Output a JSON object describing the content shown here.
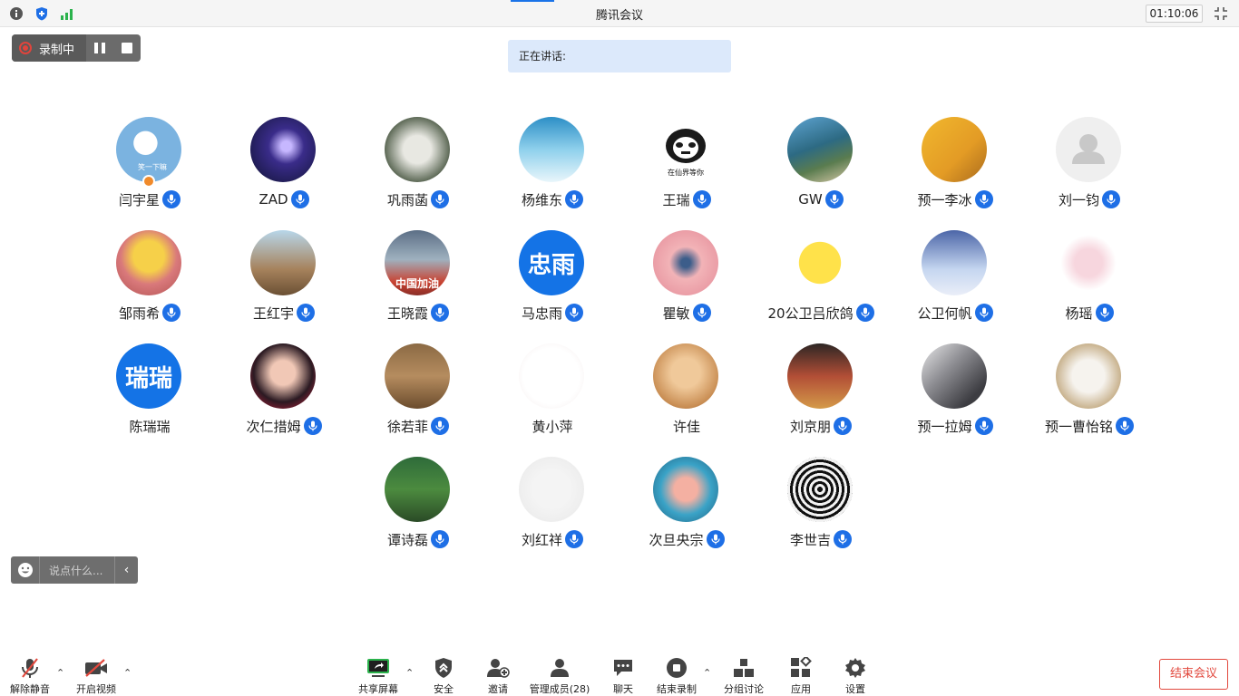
{
  "titlebar": {
    "title": "腾讯会议",
    "timer": "01:10:06"
  },
  "recording": {
    "label": "录制中"
  },
  "speaking": {
    "label": "正在讲话:"
  },
  "participants": [
    {
      "name": "闫宇星",
      "mic": true
    },
    {
      "name": "ZAD",
      "mic": true
    },
    {
      "name": "巩雨菡",
      "mic": true
    },
    {
      "name": "杨维东",
      "mic": true
    },
    {
      "name": "王瑞",
      "mic": true
    },
    {
      "name": "GW",
      "mic": true
    },
    {
      "name": "预一李冰",
      "mic": true
    },
    {
      "name": "刘一钧",
      "mic": true
    },
    {
      "name": "邹雨希",
      "mic": true
    },
    {
      "name": "王红宇",
      "mic": true
    },
    {
      "name": "王晓霞",
      "mic": true
    },
    {
      "name": "马忠雨",
      "mic": true,
      "avatar_text": "忠雨"
    },
    {
      "name": "瞿敏",
      "mic": true
    },
    {
      "name": "20公卫吕欣鸽",
      "mic": true
    },
    {
      "name": "公卫何帆",
      "mic": true
    },
    {
      "name": "杨瑶",
      "mic": true
    },
    {
      "name": "陈瑞瑞",
      "mic": false,
      "avatar_text": "瑞瑞"
    },
    {
      "name": "次仁措姆",
      "mic": true
    },
    {
      "name": "徐若菲",
      "mic": true
    },
    {
      "name": "黄小萍",
      "mic": false
    },
    {
      "name": "许佳",
      "mic": false
    },
    {
      "name": "刘京朋",
      "mic": true
    },
    {
      "name": "预一拉姆",
      "mic": true
    },
    {
      "name": "预一曹怡铭",
      "mic": true
    },
    {
      "name": "谭诗磊",
      "mic": true
    },
    {
      "name": "刘红祥",
      "mic": true
    },
    {
      "name": "次旦央宗",
      "mic": true
    },
    {
      "name": "李世吉",
      "mic": true
    }
  ],
  "avatar_images": {
    "panda_caption": "在仙界等你",
    "sign_text": "中国加油",
    "smile_text": "笑一下嘛"
  },
  "chat": {
    "placeholder": "说点什么..."
  },
  "toolbar": {
    "unmute": "解除静音",
    "video": "开启视频",
    "share": "共享屏幕",
    "security": "安全",
    "invite": "邀请",
    "members": "管理成员(28)",
    "chat": "聊天",
    "stop_record": "结束录制",
    "breakout": "分组讨论",
    "apps": "应用",
    "settings": "设置",
    "end_meeting": "结束会议"
  },
  "colors": {
    "accent": "#1e6fe6",
    "danger": "#e2483d",
    "speaking_bg": "#dce9fb"
  }
}
